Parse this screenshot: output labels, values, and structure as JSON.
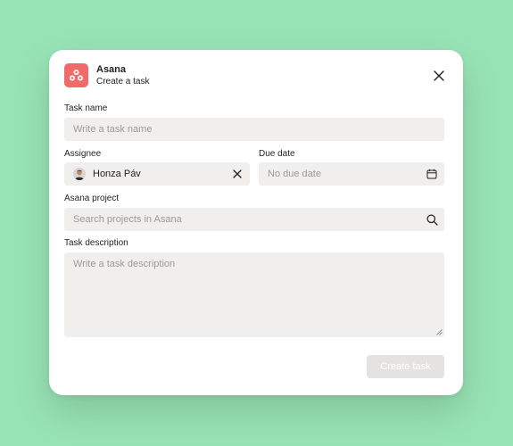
{
  "app": {
    "name": "Asana",
    "subtitle": "Create a task",
    "logo_icon": "asana-logo-icon",
    "brand_color": "#f06a6a"
  },
  "task_name": {
    "label": "Task name",
    "placeholder": "Write a task name"
  },
  "assignee": {
    "label": "Assignee",
    "value": "Honza Páv",
    "clear_icon": "close-icon"
  },
  "due_date": {
    "label": "Due date",
    "placeholder": "No due date",
    "icon": "calendar-icon"
  },
  "project": {
    "label": "Asana project",
    "placeholder": "Search projects in Asana",
    "icon": "search-icon"
  },
  "description": {
    "label": "Task description",
    "placeholder": "Write a task description"
  },
  "actions": {
    "create_label": "Create task"
  },
  "colors": {
    "background": "#98e3b5",
    "field_bg": "#f0efed",
    "disabled_button": "#e4e3e1"
  }
}
